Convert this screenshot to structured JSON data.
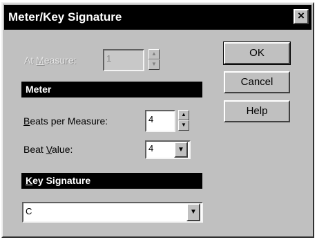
{
  "window": {
    "title": "Meter/Key Signature",
    "close_glyph": "×"
  },
  "at_measure": {
    "label_pre": "At ",
    "label_hot": "M",
    "label_post": "easure:",
    "value": "1",
    "enabled": false
  },
  "meter": {
    "section_label": "Meter",
    "beats_per_measure": {
      "label_hot": "B",
      "label_post": "eats per Measure:",
      "value": "4"
    },
    "beat_value": {
      "label_pre": "Beat ",
      "label_hot": "V",
      "label_post": "alue:",
      "value": "4"
    }
  },
  "key_signature": {
    "section_hot": "K",
    "section_post": "ey Signature",
    "value": "C"
  },
  "buttons": {
    "ok": "OK",
    "cancel": "Cancel",
    "help": "Help"
  },
  "icons": {
    "spin_up": "▲",
    "spin_down": "▼",
    "dropdown": "▼"
  }
}
